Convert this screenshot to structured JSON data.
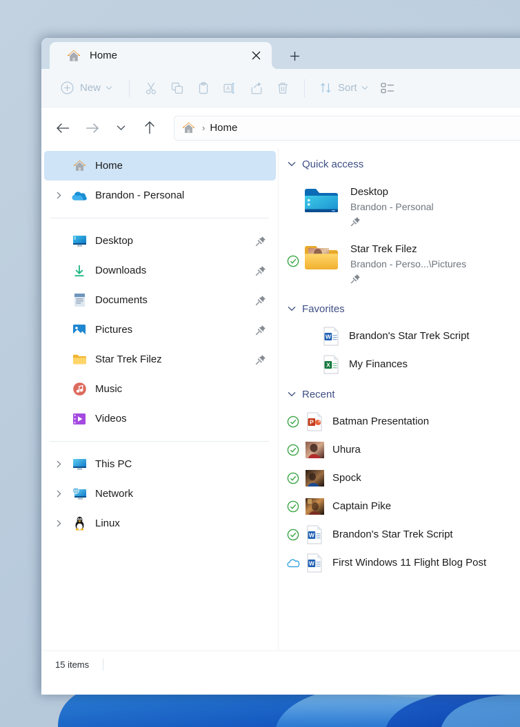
{
  "window": {
    "tab": {
      "title": "Home",
      "icon": "home-icon",
      "close_label": "✕"
    },
    "new_tab_label": "+"
  },
  "toolbar": {
    "new_label": "New",
    "sort_label": "Sort",
    "items": [
      {
        "name": "new-button",
        "icon": "plus-circle-icon",
        "label": "New"
      },
      {
        "name": "cut-button",
        "icon": "scissors-icon"
      },
      {
        "name": "copy-button",
        "icon": "copy-icon"
      },
      {
        "name": "paste-button",
        "icon": "clipboard-icon"
      },
      {
        "name": "rename-button",
        "icon": "rename-icon"
      },
      {
        "name": "share-button",
        "icon": "share-icon"
      },
      {
        "name": "delete-button",
        "icon": "trash-icon"
      },
      {
        "name": "sort-button",
        "icon": "sort-arrows-icon",
        "label": "Sort"
      },
      {
        "name": "view-button",
        "icon": "view-list-icon"
      }
    ]
  },
  "address": {
    "back_label": "←",
    "forward_label": "→",
    "recent_label": "⌄",
    "up_label": "↑",
    "crumb_separator": "›",
    "crumb": "Home",
    "crumb_icon": "home-icon"
  },
  "sidebar": {
    "items": [
      {
        "label": "Home",
        "icon": "home-icon",
        "selected": true,
        "chevron": false,
        "pinned": false
      },
      {
        "label": "Brandon - Personal",
        "icon": "onedrive-cloud-icon",
        "selected": false,
        "chevron": true,
        "pinned": false
      },
      {
        "divider": true
      },
      {
        "label": "Desktop",
        "icon": "desktop-monitor-icon",
        "selected": false,
        "chevron": false,
        "pinned": true
      },
      {
        "label": "Downloads",
        "icon": "download-arrow-icon",
        "selected": false,
        "chevron": false,
        "pinned": true
      },
      {
        "label": "Documents",
        "icon": "documents-icon",
        "selected": false,
        "chevron": false,
        "pinned": true
      },
      {
        "label": "Pictures",
        "icon": "pictures-icon",
        "selected": false,
        "chevron": false,
        "pinned": true
      },
      {
        "label": "Star Trek Filez",
        "icon": "folder-icon",
        "selected": false,
        "chevron": false,
        "pinned": true
      },
      {
        "label": "Music",
        "icon": "music-note-icon",
        "selected": false,
        "chevron": false,
        "pinned": false
      },
      {
        "label": "Videos",
        "icon": "videos-film-icon",
        "selected": false,
        "chevron": false,
        "pinned": false
      },
      {
        "divider": true
      },
      {
        "label": "This PC",
        "icon": "this-pc-icon",
        "selected": false,
        "chevron": true,
        "pinned": false
      },
      {
        "label": "Network",
        "icon": "network-icon",
        "selected": false,
        "chevron": true,
        "pinned": false
      },
      {
        "label": "Linux",
        "icon": "linux-penguin-icon",
        "selected": false,
        "chevron": true,
        "pinned": false
      }
    ]
  },
  "content": {
    "groups": [
      {
        "title": "Quick access",
        "expanded": true,
        "layout": "tiles",
        "items": [
          {
            "name": "Desktop",
            "path": "Brandon - Personal",
            "icon": "desktop-folder-icon",
            "pinned": true,
            "sync": "none"
          },
          {
            "name": "Star Trek Filez",
            "path": "Brandon - Perso...\\Pictures",
            "icon": "photo-folder-icon",
            "pinned": true,
            "sync": "synced"
          }
        ]
      },
      {
        "title": "Favorites",
        "expanded": true,
        "layout": "list",
        "items": [
          {
            "name": "Brandon's Star Trek Script",
            "icon": "word-doc-icon",
            "sync": "none"
          },
          {
            "name": "My Finances",
            "icon": "excel-doc-icon",
            "sync": "none"
          }
        ]
      },
      {
        "title": "Recent",
        "expanded": true,
        "layout": "list",
        "items": [
          {
            "name": "Batman Presentation",
            "icon": "powerpoint-doc-icon",
            "sync": "synced"
          },
          {
            "name": "Uhura",
            "icon": "photo-thumb-uhura-icon",
            "sync": "synced"
          },
          {
            "name": "Spock",
            "icon": "photo-thumb-spock-icon",
            "sync": "synced"
          },
          {
            "name": "Captain Pike",
            "icon": "photo-thumb-pike-icon",
            "sync": "synced"
          },
          {
            "name": "Brandon's Star Trek Script",
            "icon": "word-doc-icon",
            "sync": "synced"
          },
          {
            "name": "First Windows 11 Flight Blog Post",
            "icon": "word-doc-icon",
            "sync": "cloud-only"
          }
        ]
      }
    ]
  },
  "status": {
    "item_count": "15 items"
  },
  "colors": {
    "titlebar": "#ccdbe7",
    "toolbar": "#f3f7fa",
    "selection": "#cfe4f7",
    "group_header": "#3f4f86",
    "sync_green": "#3aa544",
    "sync_cloud_blue": "#2e9fe0",
    "accent_orange": "#e8870f"
  }
}
